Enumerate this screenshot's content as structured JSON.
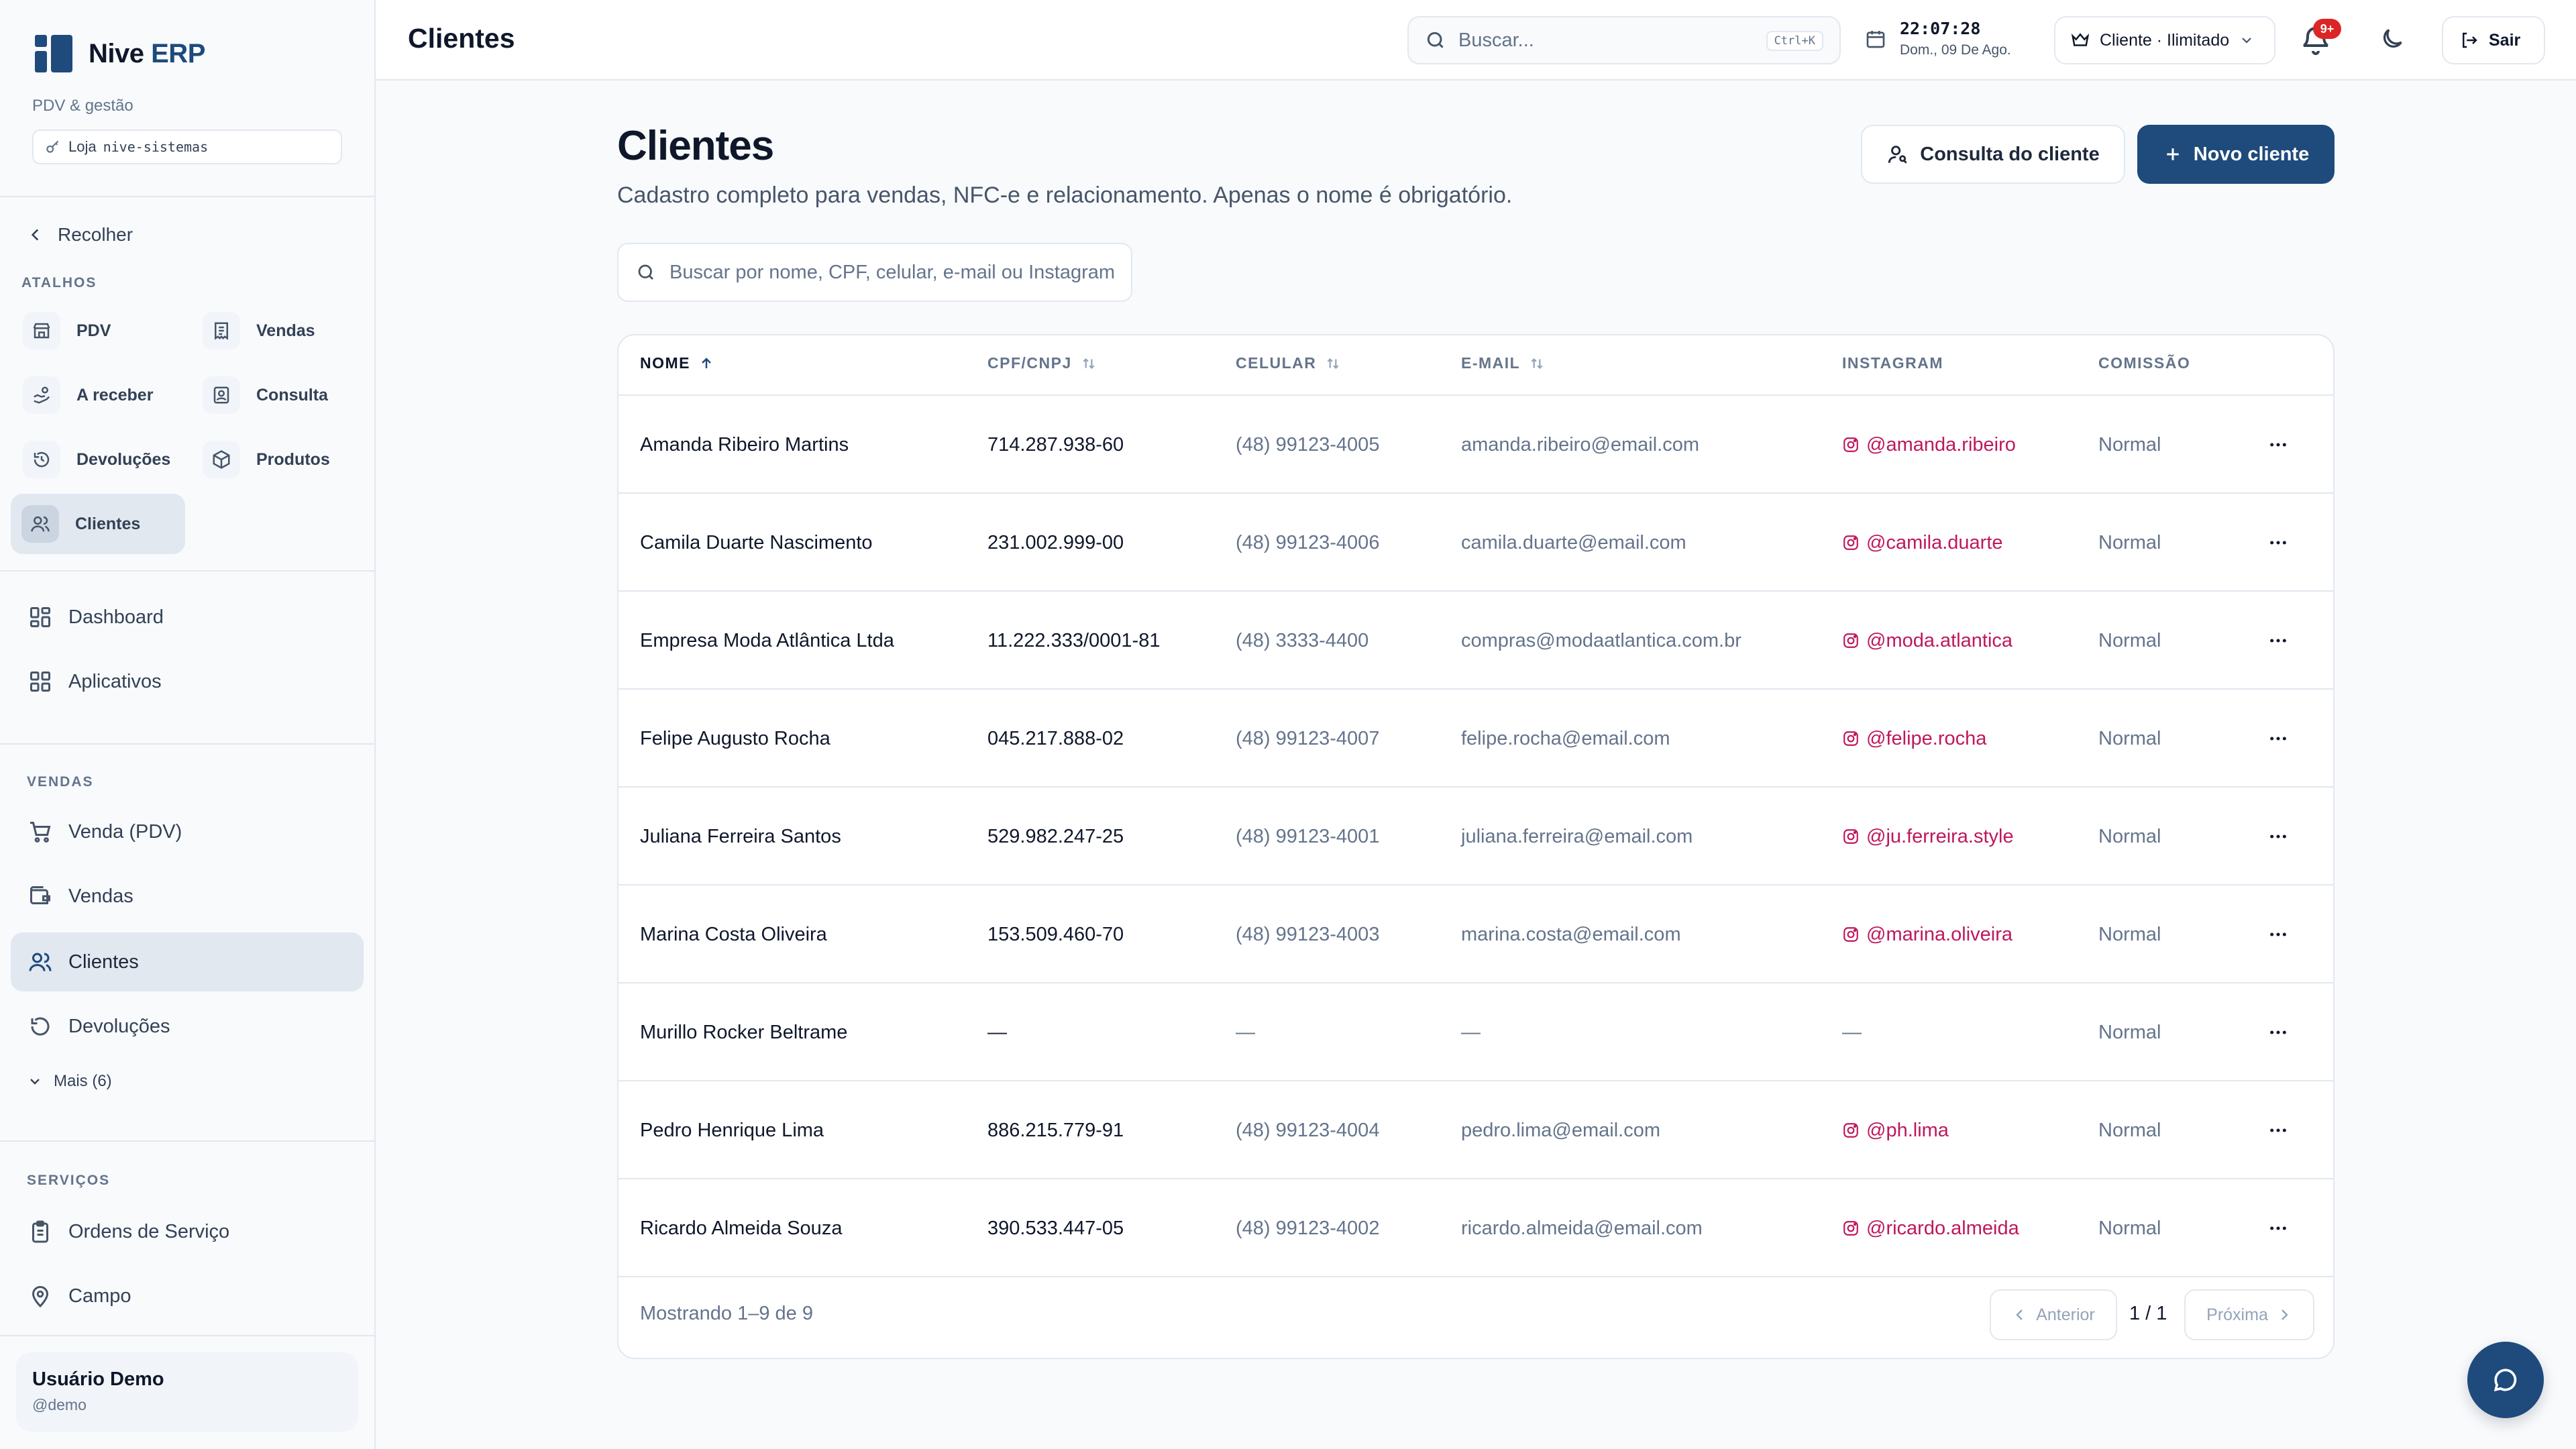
{
  "app": {
    "name": "Nive",
    "name_accent": "ERP",
    "subtitle": "PDV & gestão",
    "store_prefix": "Loja",
    "store_id": "nive-sistemas"
  },
  "sidebar": {
    "collapse_label": "Recolher",
    "shortcuts_label": "Atalhos",
    "shortcuts": [
      {
        "label": "PDV",
        "icon": "store-icon"
      },
      {
        "label": "Vendas",
        "icon": "receipt-icon"
      },
      {
        "label": "A receber",
        "icon": "hand-coins-icon"
      },
      {
        "label": "Consulta",
        "icon": "contact-card-icon"
      },
      {
        "label": "Devoluções",
        "icon": "history-icon"
      },
      {
        "label": "Produtos",
        "icon": "package-icon"
      },
      {
        "label": "Clientes",
        "icon": "users-icon",
        "active": true
      }
    ],
    "main_items": [
      {
        "label": "Dashboard",
        "icon": "dashboard-icon"
      },
      {
        "label": "Aplicativos",
        "icon": "grid-icon"
      }
    ],
    "sales_label": "Vendas",
    "sales_items": [
      {
        "label": "Venda (PDV)",
        "icon": "cart-icon"
      },
      {
        "label": "Vendas",
        "icon": "wallet-icon"
      },
      {
        "label": "Clientes",
        "icon": "users-icon",
        "active": true
      },
      {
        "label": "Devoluções",
        "icon": "undo-icon"
      }
    ],
    "more_label": "Mais (6)",
    "services_label": "Serviços",
    "services_items": [
      {
        "label": "Ordens de Serviço",
        "icon": "clipboard-icon"
      },
      {
        "label": "Campo",
        "icon": "map-pin-icon"
      }
    ],
    "user": {
      "name": "Usuário Demo",
      "handle": "@demo"
    }
  },
  "topbar": {
    "title": "Clientes",
    "search_placeholder": "Buscar...",
    "search_shortcut": "Ctrl+K",
    "time": "22:07:28",
    "date": "Dom., 09 De Ago.",
    "plan": "Cliente · Ilimitado",
    "notifications_badge": "9+",
    "logout": "Sair"
  },
  "page": {
    "title": "Clientes",
    "subtitle": "Cadastro completo para vendas, NFC-e e relacionamento. Apenas o nome é obrigatório.",
    "consult_button": "Consulta do cliente",
    "new_button": "Novo cliente",
    "search_placeholder": "Buscar por nome, CPF, celular, e-mail ou Instagram"
  },
  "table": {
    "columns": {
      "name": "Nome",
      "doc": "CPF/CNPJ",
      "phone": "Celular",
      "email": "E-mail",
      "instagram": "Instagram",
      "commission": "Comissão"
    },
    "rows": [
      {
        "name": "Amanda Ribeiro Martins",
        "doc": "714.287.938-60",
        "phone": "(48) 99123-4005",
        "email": "amanda.ribeiro@email.com",
        "instagram": "@amanda.ribeiro",
        "commission": "Normal"
      },
      {
        "name": "Camila Duarte Nascimento",
        "doc": "231.002.999-00",
        "phone": "(48) 99123-4006",
        "email": "camila.duarte@email.com",
        "instagram": "@camila.duarte",
        "commission": "Normal"
      },
      {
        "name": "Empresa Moda Atlântica Ltda",
        "doc": "11.222.333/0001-81",
        "phone": "(48) 3333-4400",
        "email": "compras@modaatlantica.com.br",
        "instagram": "@moda.atlantica",
        "commission": "Normal"
      },
      {
        "name": "Felipe Augusto Rocha",
        "doc": "045.217.888-02",
        "phone": "(48) 99123-4007",
        "email": "felipe.rocha@email.com",
        "instagram": "@felipe.rocha",
        "commission": "Normal"
      },
      {
        "name": "Juliana Ferreira Santos",
        "doc": "529.982.247-25",
        "phone": "(48) 99123-4001",
        "email": "juliana.ferreira@email.com",
        "instagram": "@ju.ferreira.style",
        "commission": "Normal"
      },
      {
        "name": "Marina Costa Oliveira",
        "doc": "153.509.460-70",
        "phone": "(48) 99123-4003",
        "email": "marina.costa@email.com",
        "instagram": "@marina.oliveira",
        "commission": "Normal"
      },
      {
        "name": "Murillo Rocker Beltrame",
        "doc": "—",
        "phone": "—",
        "email": "—",
        "instagram": "—",
        "commission": "Normal"
      },
      {
        "name": "Pedro Henrique Lima",
        "doc": "886.215.779-91",
        "phone": "(48) 99123-4004",
        "email": "pedro.lima@email.com",
        "instagram": "@ph.lima",
        "commission": "Normal"
      },
      {
        "name": "Ricardo Almeida Souza",
        "doc": "390.533.447-05",
        "phone": "(48) 99123-4002",
        "email": "ricardo.almeida@email.com",
        "instagram": "@ricardo.almeida",
        "commission": "Normal"
      }
    ],
    "footer": {
      "showing": "Mostrando 1–9 de 9",
      "prev": "Anterior",
      "page": "1 / 1",
      "next": "Próxima"
    }
  },
  "colors": {
    "brand": "#1e4a7c",
    "instagram": "#be185d",
    "badge": "#dc2626"
  }
}
